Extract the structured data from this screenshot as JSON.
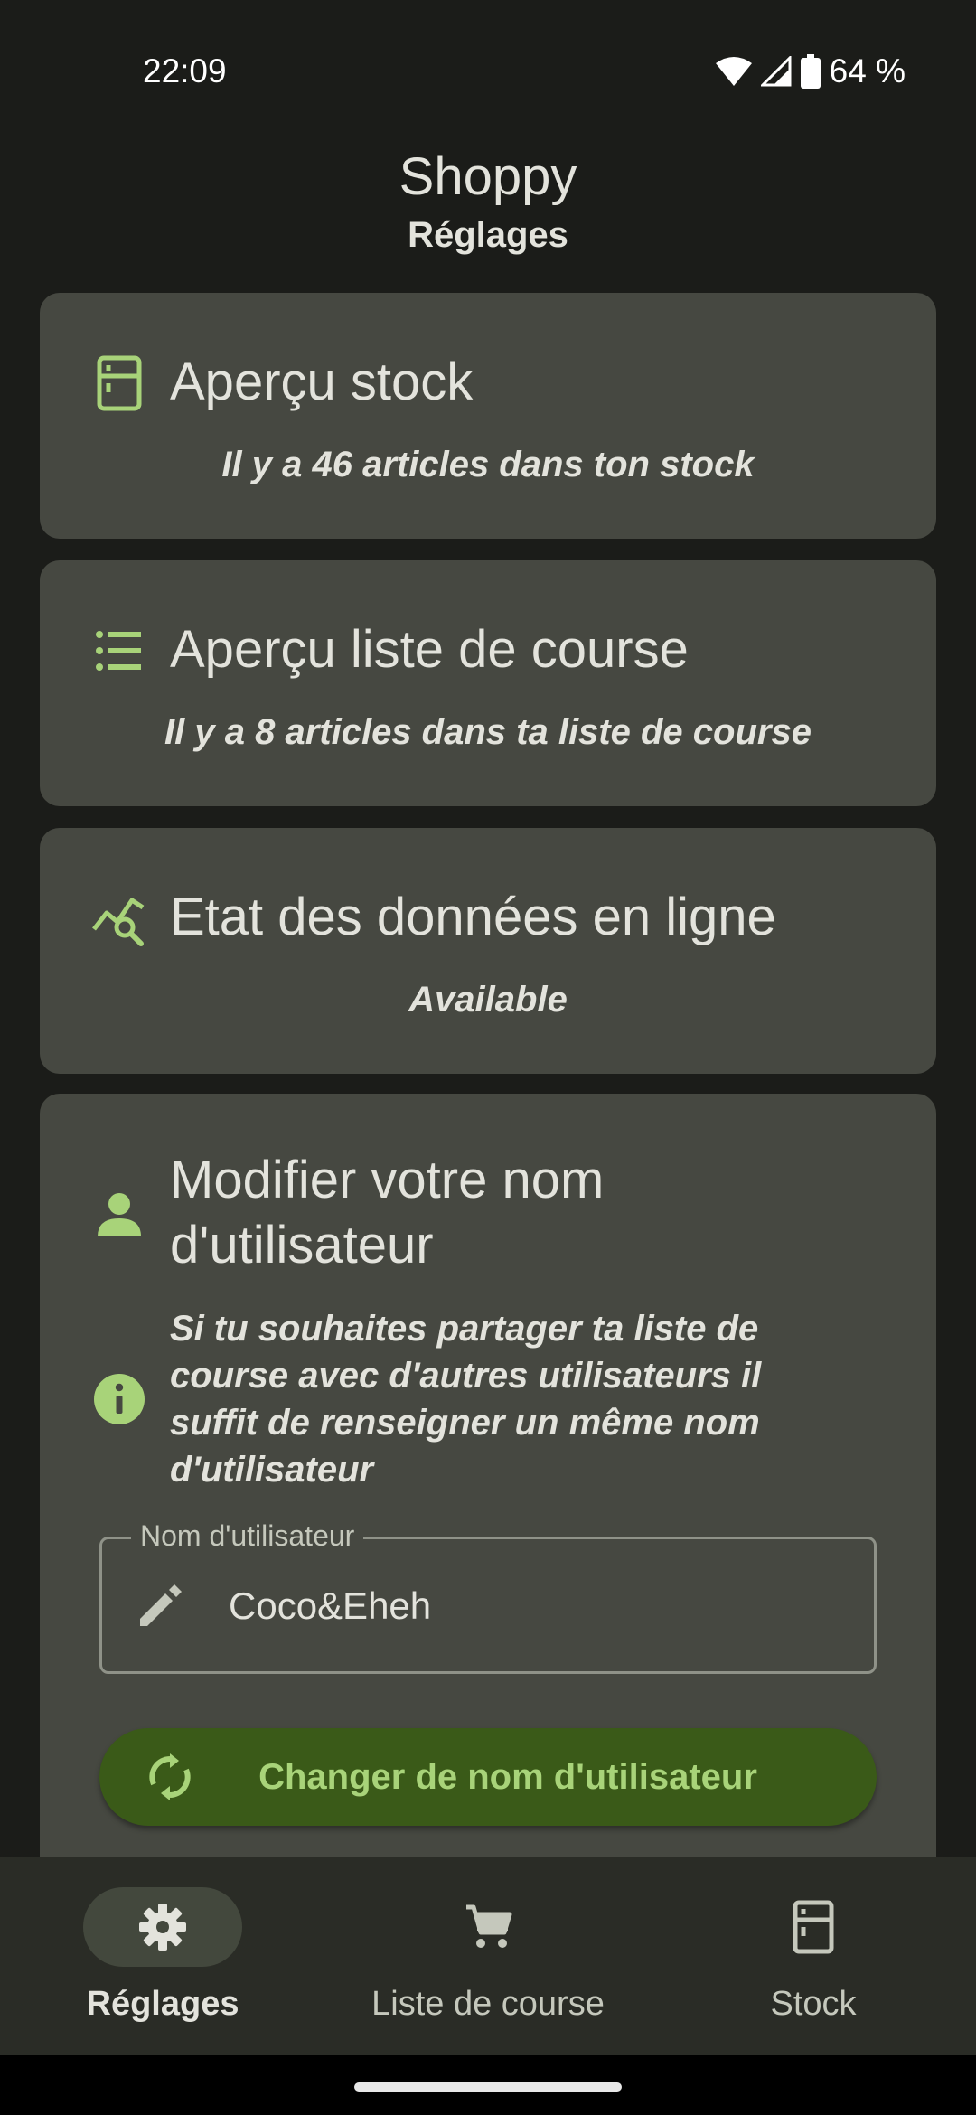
{
  "status_bar": {
    "time": "22:09",
    "battery": "64 %"
  },
  "header": {
    "app_title": "Shoppy",
    "page_title": "Réglages"
  },
  "cards": {
    "stock": {
      "title": "Aperçu stock",
      "subtitle": "Il y a 46 articles dans ton stock",
      "icon": "fridge-icon"
    },
    "shopping_list": {
      "title": "Aperçu liste de course",
      "subtitle": "Il y a 8 articles dans ta liste de course",
      "icon": "list-icon"
    },
    "online_data": {
      "title": "Etat des données en ligne",
      "subtitle": "Available",
      "icon": "query-stats-icon"
    },
    "username": {
      "title_line1": "Modifier votre nom",
      "title_line2": "d'utilisateur",
      "info": "Si tu souhaites partager ta liste de course avec d'autres utilisateurs il suffit de renseigner un même nom d'utilisateur",
      "field_label": "Nom d'utilisateur",
      "field_value": "Coco&Eheh",
      "button_label": "Changer de nom d'utilisateur",
      "icon": "person-icon"
    }
  },
  "bottom_nav": {
    "items": [
      {
        "label": "Réglages",
        "icon": "gear-icon",
        "active": true
      },
      {
        "label": "Liste de course",
        "icon": "cart-icon",
        "active": false
      },
      {
        "label": "Stock",
        "icon": "fridge-icon",
        "active": false
      }
    ]
  },
  "colors": {
    "background": "#1b1c19",
    "card": "#464841",
    "accent": "#a8d379",
    "button": "#3a5a18",
    "navbar": "#2a2c26"
  }
}
